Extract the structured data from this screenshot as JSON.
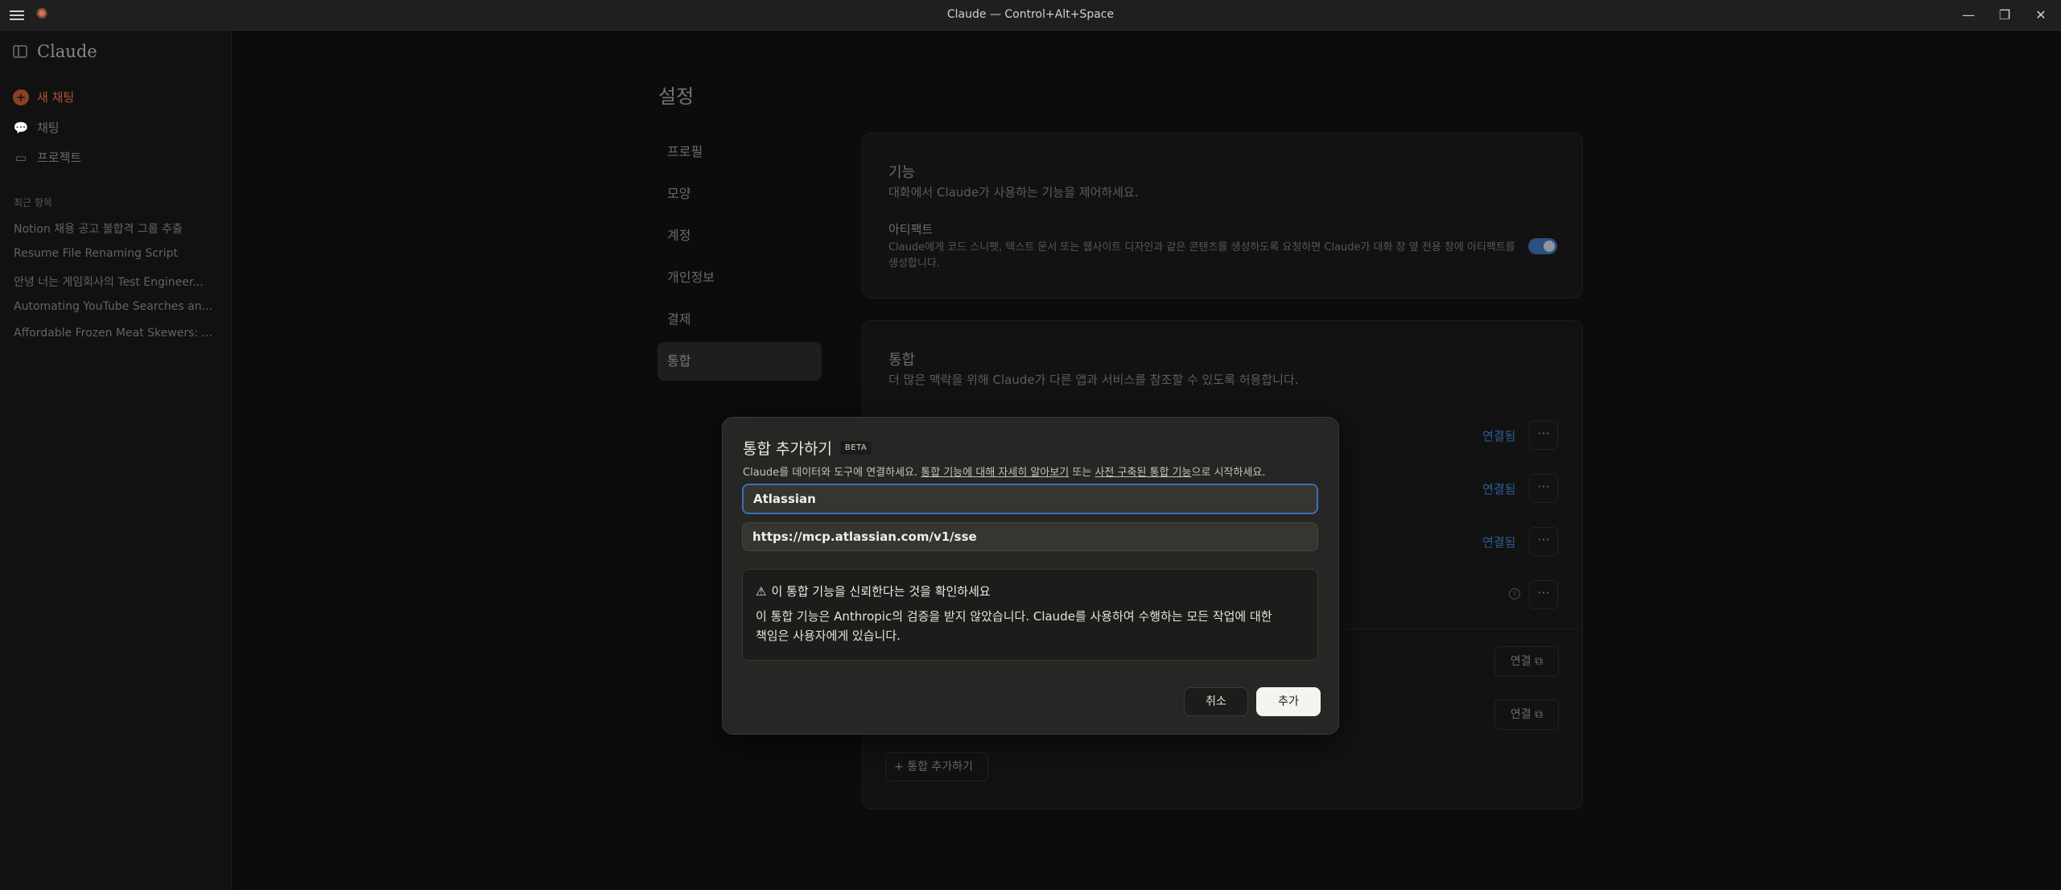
{
  "titlebar": {
    "title": "Claude — Control+Alt+Space"
  },
  "sidebar": {
    "brand": "Claude",
    "new_chat": "새 채팅",
    "chats": "채팅",
    "projects": "프로젝트",
    "recent_label": "최근 항목",
    "recent": [
      "Notion 채용 공고 불합격 그룹 추출",
      "Resume File Renaming Script",
      "안녕 너는 게임회사의 Test Engineer...",
      "Automating YouTube Searches an...",
      "Affordable Frozen Meat Skewers: ..."
    ]
  },
  "settings": {
    "title": "설정",
    "nav": [
      "프로필",
      "모양",
      "계정",
      "개인정보",
      "결제",
      "통합"
    ],
    "active_nav": "통합",
    "features": {
      "title": "기능",
      "subtitle": "대화에서 Claude가 사용하는 기능을 제어하세요.",
      "artifacts_title": "아티팩트",
      "artifacts_desc": "Claude에게 코드 스니펫, 텍스트 문서 또는 웹사이트 디자인과 같은 콘텐츠를 생성하도록 요청하면 Claude가 대화 창 옆 전용 창에 아티팩트를 생성합니다.",
      "artifacts_enabled": true
    },
    "integrations": {
      "title": "통합",
      "subtitle": "더 많은 맥락을 위해 Claude가 다른 앱과 서비스를 참조할 수 있도록 허용합니다.",
      "connected_label": "연결됨",
      "connect_label": "연결",
      "add_label": "통합 추가하기"
    }
  },
  "modal": {
    "title": "통합 추가하기",
    "badge": "BETA",
    "subtitle_pre": "Claude를 데이터와 도구에 연결하세요. ",
    "link1": "통합 기능에 대해 자세히 알아보기",
    "subtitle_mid": " 또는 ",
    "link2": "사전 구축된 통합 기능",
    "subtitle_post": "으로 시작하세요.",
    "name_value": "Atlassian",
    "url_value": "https://mcp.atlassian.com/v1/sse",
    "warning_title": "이 통합 기능을 신뢰한다는 것을 확인하세요",
    "warning_text": "이 통합 기능은 Anthropic의 검증을 받지 않았습니다. Claude를 사용하여 수행하는 모든 작업에 대한 책임은 사용자에게 있습니다.",
    "cancel": "취소",
    "add": "추가"
  },
  "colors": {
    "accent": "#d97757",
    "link_blue": "#3b6fb6",
    "primary_button": "#f5f3ee"
  }
}
